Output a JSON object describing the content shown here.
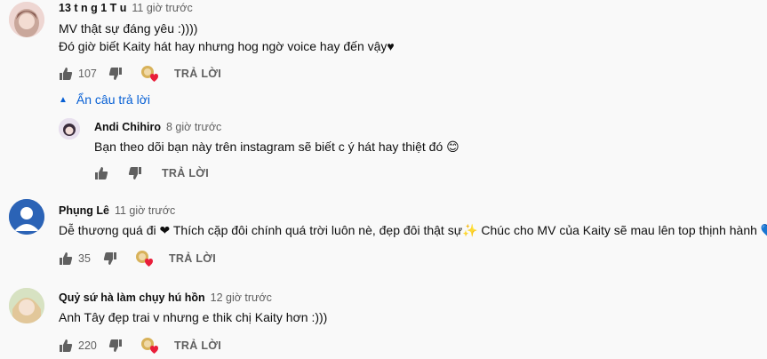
{
  "comments": [
    {
      "author": "13 t n g 1 T u",
      "time": "11 giờ trước",
      "lines": [
        "MV thật sự đáng yêu :))))",
        "Đó giờ biết Kaity hát hay nhưng hog ngờ voice hay đến vậy♥"
      ],
      "likes": "107",
      "reply_label": "TRẢ LỜI",
      "avatar_color": "#e8b9b7"
    },
    {
      "author": "Phụng Lê",
      "time": "11 giờ trước",
      "lines": [
        "Dễ thương quá đi ❤ Thích cặp đôi chính quá trời luôn nè, đẹp đôi thật sự✨ Chúc cho MV của Kaity sẽ mau lên top thịnh hành 💙"
      ],
      "likes": "35",
      "reply_label": "TRẢ LỜI",
      "avatar_color": "#2b63b6"
    },
    {
      "author": "Quỷ sứ hà làm chụy hú hồn",
      "time": "12 giờ trước",
      "lines": [
        "Anh Tây đẹp trai v nhưng e thik chị Kaity hơn :)))"
      ],
      "likes": "220",
      "reply_label": "TRẢ LỜI",
      "avatar_color": "#cfd9b8"
    }
  ],
  "reply_toggle": "Ẩn câu trả lời",
  "reply": {
    "author": "Andi Chihiro",
    "time": "8 giờ trước",
    "text": "Bạn theo dõi bạn này trên instagram sẽ biết c ý hát hay thiệt đó 😊",
    "reply_label": "TRẢ LỜI",
    "avatar_color": "#d9cbe6"
  },
  "colors": {
    "link": "#065fd4",
    "muted": "#606060",
    "heart": "#e91e3a"
  },
  "icons": [
    "like-icon",
    "dislike-icon",
    "creator-heart-icon",
    "caret-up-icon"
  ]
}
